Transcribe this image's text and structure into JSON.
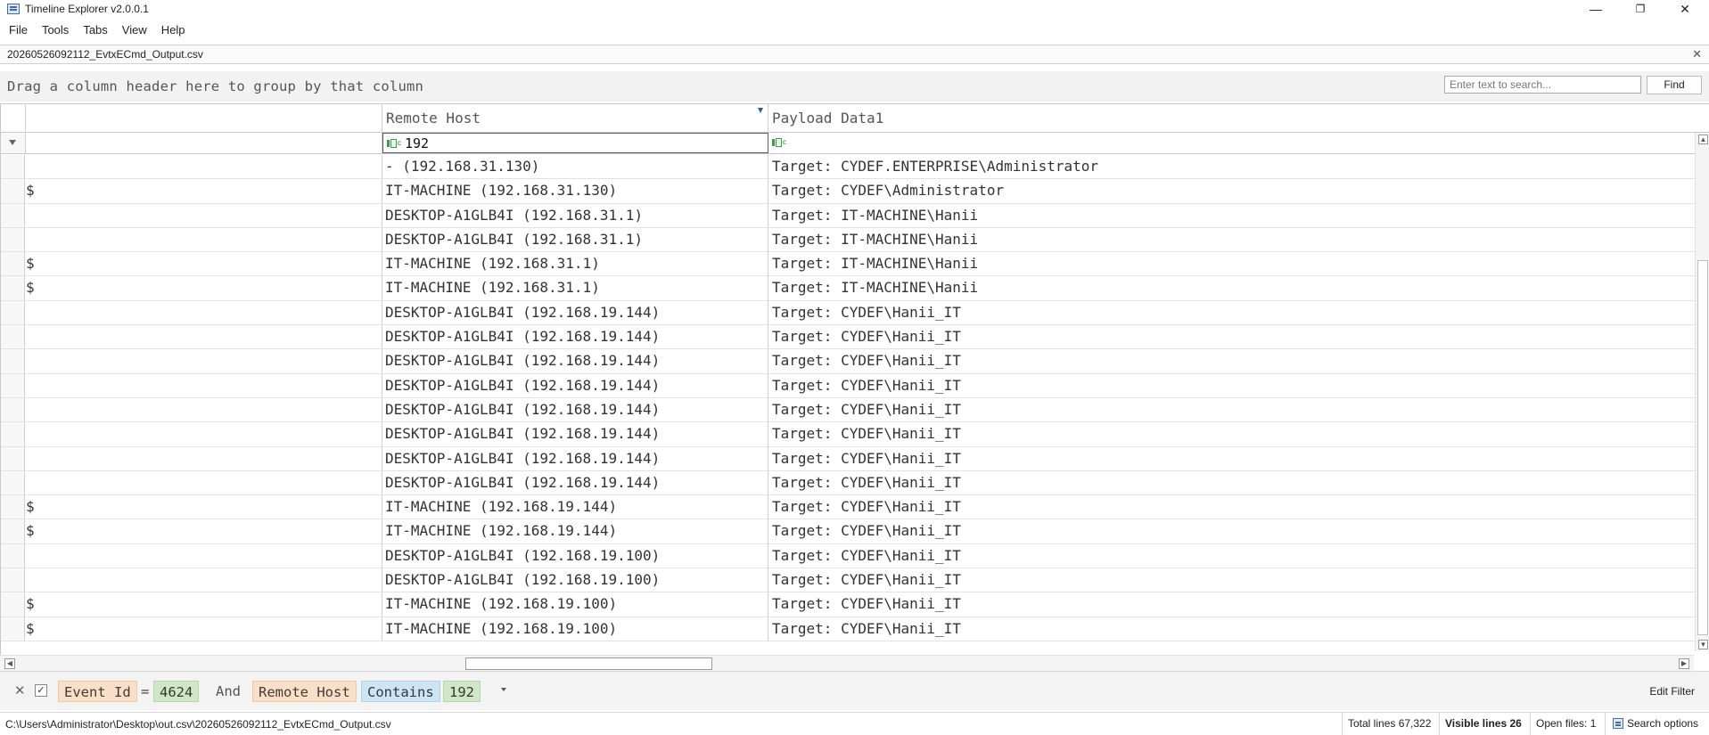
{
  "window": {
    "title": "Timeline Explorer v2.0.0.1",
    "minimize": "—",
    "restore": "❐",
    "close": "✕"
  },
  "menu": [
    "File",
    "Tools",
    "Tabs",
    "View",
    "Help"
  ],
  "tab": {
    "filename": "20260526092112_EvtxECmd_Output.csv",
    "close": "✕"
  },
  "group_panel": {
    "hint": "Drag a column header here to group by that column"
  },
  "search": {
    "placeholder": "Enter text to search...",
    "find_label": "Find"
  },
  "grid": {
    "columns": [
      "",
      "Remote Host",
      "Payload Data1"
    ],
    "filters": {
      "remote_host": "192",
      "payload_data1": ""
    },
    "rows": [
      {
        "c0": "",
        "remote_host": "- (192.168.31.130)",
        "payload": "Target: CYDEF.ENTERPRISE\\Administrator"
      },
      {
        "c0": "$",
        "remote_host": "IT-MACHINE (192.168.31.130)",
        "payload": "Target: CYDEF\\Administrator"
      },
      {
        "c0": "",
        "remote_host": "DESKTOP-A1GLB4I (192.168.31.1)",
        "payload": "Target: IT-MACHINE\\Hanii"
      },
      {
        "c0": "",
        "remote_host": "DESKTOP-A1GLB4I (192.168.31.1)",
        "payload": "Target: IT-MACHINE\\Hanii"
      },
      {
        "c0": "$",
        "remote_host": "IT-MACHINE (192.168.31.1)",
        "payload": "Target: IT-MACHINE\\Hanii"
      },
      {
        "c0": "$",
        "remote_host": "IT-MACHINE (192.168.31.1)",
        "payload": "Target: IT-MACHINE\\Hanii"
      },
      {
        "c0": "",
        "remote_host": "DESKTOP-A1GLB4I (192.168.19.144)",
        "payload": "Target: CYDEF\\Hanii_IT"
      },
      {
        "c0": "",
        "remote_host": "DESKTOP-A1GLB4I (192.168.19.144)",
        "payload": "Target: CYDEF\\Hanii_IT"
      },
      {
        "c0": "",
        "remote_host": "DESKTOP-A1GLB4I (192.168.19.144)",
        "payload": "Target: CYDEF\\Hanii_IT"
      },
      {
        "c0": "",
        "remote_host": "DESKTOP-A1GLB4I (192.168.19.144)",
        "payload": "Target: CYDEF\\Hanii_IT"
      },
      {
        "c0": "",
        "remote_host": "DESKTOP-A1GLB4I (192.168.19.144)",
        "payload": "Target: CYDEF\\Hanii_IT"
      },
      {
        "c0": "",
        "remote_host": "DESKTOP-A1GLB4I (192.168.19.144)",
        "payload": "Target: CYDEF\\Hanii_IT"
      },
      {
        "c0": "",
        "remote_host": "DESKTOP-A1GLB4I (192.168.19.144)",
        "payload": "Target: CYDEF\\Hanii_IT"
      },
      {
        "c0": "",
        "remote_host": "DESKTOP-A1GLB4I (192.168.19.144)",
        "payload": "Target: CYDEF\\Hanii_IT"
      },
      {
        "c0": "$",
        "remote_host": "IT-MACHINE (192.168.19.144)",
        "payload": "Target: CYDEF\\Hanii_IT"
      },
      {
        "c0": "$",
        "remote_host": "IT-MACHINE (192.168.19.144)",
        "payload": "Target: CYDEF\\Hanii_IT"
      },
      {
        "c0": "",
        "remote_host": "DESKTOP-A1GLB4I (192.168.19.100)",
        "payload": "Target: CYDEF\\Hanii_IT"
      },
      {
        "c0": "",
        "remote_host": "DESKTOP-A1GLB4I (192.168.19.100)",
        "payload": "Target: CYDEF\\Hanii_IT"
      },
      {
        "c0": "$",
        "remote_host": "IT-MACHINE (192.168.19.100)",
        "payload": "Target: CYDEF\\Hanii_IT"
      },
      {
        "c0": "$",
        "remote_host": "IT-MACHINE (192.168.19.100)",
        "payload": "Target: CYDEF\\Hanii_IT"
      }
    ]
  },
  "filter_bar": {
    "clear": "✕",
    "checked": "✓",
    "field1": "Event Id",
    "eq": "=",
    "value1": "4624",
    "conj": "And",
    "field2": "Remote Host",
    "op2": "Contains",
    "value2": "192",
    "edit_filter": "Edit Filter"
  },
  "status": {
    "path": "C:\\Users\\Administrator\\Desktop\\out.csv\\20260526092112_EvtxECmd_Output.csv",
    "total_lines": "Total lines 67,322",
    "visible_lines": "Visible lines 26",
    "open_files": "Open files: 1",
    "search_options": "Search options"
  },
  "colors": {
    "field_chip": "#f8dfc9",
    "value_chip": "#cfe7c6",
    "operator_chip": "#cde4f2",
    "filter_badge": "#39a047"
  },
  "icons": [
    "app-icon",
    "filter-row-icon",
    "filter-contains-icon",
    "column-filter-indicator-icon",
    "search-options-icon"
  ]
}
